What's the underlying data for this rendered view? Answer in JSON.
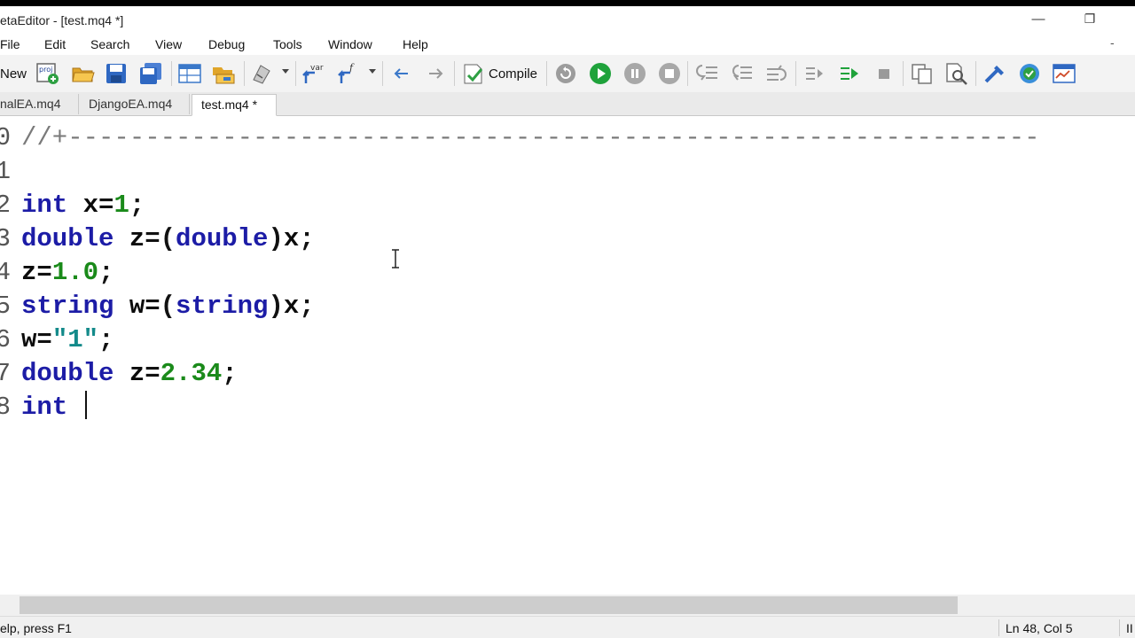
{
  "window": {
    "title": "etaEditor - [test.mq4 *]",
    "minimize_glyph": "—",
    "restore_glyph": "❐",
    "mdi_minimize_glyph": "-"
  },
  "menu": [
    "File",
    "Edit",
    "Search",
    "View",
    "Debug",
    "Tools",
    "Window",
    "Help"
  ],
  "toolbar": {
    "new_label": "New",
    "compile_label": "Compile",
    "new_project_badge": "proj",
    "var_badge": "var",
    "func_badge": "f"
  },
  "tabs": [
    {
      "label": "nalEA.mq4",
      "active": false
    },
    {
      "label": "DjangoEA.mq4",
      "active": false
    },
    {
      "label": "test.mq4 *",
      "active": true
    }
  ],
  "editor": {
    "line_numbers": [
      "0",
      "1",
      "2",
      "3",
      "4",
      "5",
      "6",
      "7",
      "8"
    ],
    "lines": [
      [
        {
          "t": "//+---------------------------------------------------------------",
          "c": "cm"
        }
      ],
      [],
      [
        {
          "t": "int",
          "c": "kw"
        },
        {
          "t": " x",
          "c": "id"
        },
        {
          "t": "=",
          "c": "op"
        },
        {
          "t": "1",
          "c": "num"
        },
        {
          "t": ";",
          "c": "op"
        }
      ],
      [
        {
          "t": "double",
          "c": "kw"
        },
        {
          "t": " z",
          "c": "id"
        },
        {
          "t": "=(",
          "c": "op"
        },
        {
          "t": "double",
          "c": "kw"
        },
        {
          "t": ")",
          "c": "op"
        },
        {
          "t": "x",
          "c": "id"
        },
        {
          "t": ";",
          "c": "op"
        }
      ],
      [
        {
          "t": "z",
          "c": "id"
        },
        {
          "t": "=",
          "c": "op"
        },
        {
          "t": "1.0",
          "c": "num"
        },
        {
          "t": ";",
          "c": "op"
        }
      ],
      [
        {
          "t": "string",
          "c": "kw"
        },
        {
          "t": " w",
          "c": "id"
        },
        {
          "t": "=(",
          "c": "op"
        },
        {
          "t": "string",
          "c": "kw"
        },
        {
          "t": ")",
          "c": "op"
        },
        {
          "t": "x",
          "c": "id"
        },
        {
          "t": ";",
          "c": "op"
        }
      ],
      [
        {
          "t": "w",
          "c": "id"
        },
        {
          "t": "=",
          "c": "op"
        },
        {
          "t": "\"1\"",
          "c": "str"
        },
        {
          "t": ";",
          "c": "op"
        }
      ],
      [
        {
          "t": "double",
          "c": "kw"
        },
        {
          "t": " z",
          "c": "id"
        },
        {
          "t": "=",
          "c": "op"
        },
        {
          "t": "2.34",
          "c": "num"
        },
        {
          "t": ";",
          "c": "op"
        }
      ],
      [
        {
          "t": "int",
          "c": "kw"
        },
        {
          "t": " ",
          "c": "id"
        }
      ]
    ]
  },
  "status": {
    "help": "elp, press F1",
    "position": "Ln 48, Col 5",
    "mode": "II"
  },
  "colors": {
    "keyword": "#1c1ca6",
    "number": "#1a8a1a",
    "string": "#138a8a",
    "comment": "#7a7a7a"
  }
}
